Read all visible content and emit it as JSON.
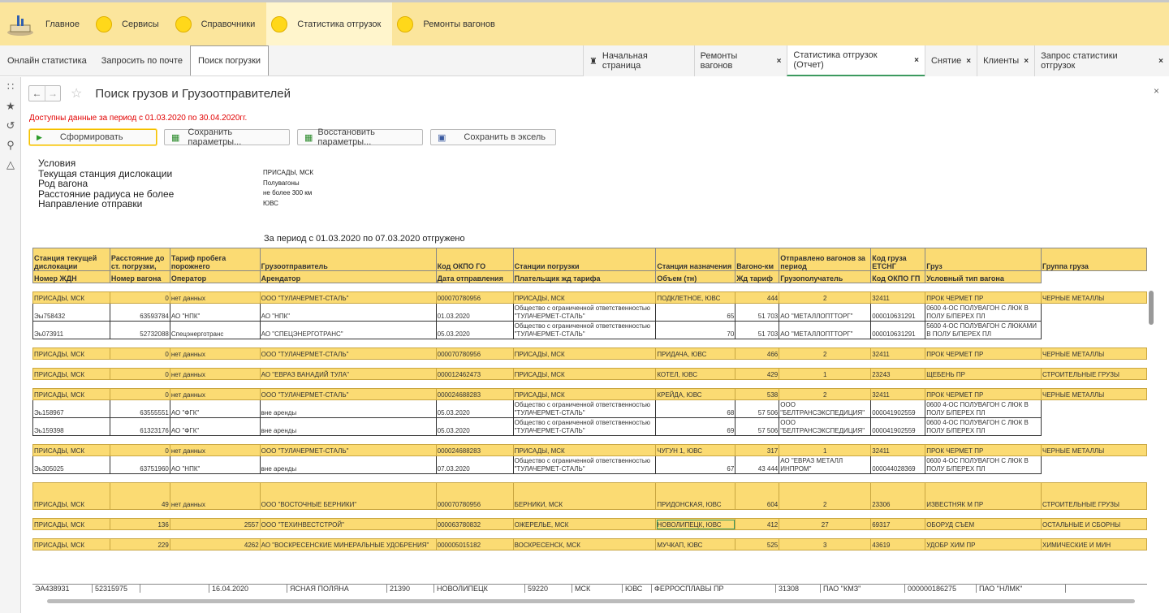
{
  "sections": [
    {
      "label": "Главное"
    },
    {
      "label": "Сервисы"
    },
    {
      "label": "Справочники"
    },
    {
      "label": "Статистика отгрузок"
    },
    {
      "label": "Ремонты вагонов"
    }
  ],
  "subnav": [
    "Онлайн статистика",
    "Запросить по почте",
    "Поиск погрузки"
  ],
  "tabs": [
    "Начальная страница",
    "Ремонты вагонов",
    "Статистика отгрузок (Отчет)",
    "Снятие",
    "Клиенты",
    "Запрос статистики отгрузок"
  ],
  "page": {
    "title": "Поиск грузов и Грузоотправителей",
    "warning": "Доступны данные за период с 01.03.2020 по 30.04.2020гг.",
    "buttons": [
      "Сформировать",
      "Сохранить параметры...",
      "Восстановить параметры...",
      "Сохранить в эксель"
    ],
    "conditions_title": "Условия",
    "conditions": [
      {
        "label": "Текущая станция дислокации",
        "value": "ПРИСАДЫ, МСК"
      },
      {
        "label": "Род вагона",
        "value": "Полувагоны"
      },
      {
        "label": "Расстояние радиуса не более",
        "value": "не более 300 км"
      },
      {
        "label": "Направление отправки",
        "value": "ЮВС"
      }
    ],
    "period": "За период с 01.03.2020 по 07.03.2020 отгружено"
  },
  "table": {
    "header1": [
      "Станция текущей дислокации",
      "Расстояние до ст. погрузки,",
      "Тариф пробега порожнего",
      "Грузоотправитель",
      "Код ОКПО ГО",
      "Станции погрузки",
      "Станция назначения",
      "Вагоно-км",
      "Отправлено вагонов за период",
      "Код груза ЕТСНГ",
      "Груз",
      "Группа груза"
    ],
    "header2": [
      "Номер ЖДН",
      "Номер вагона",
      "Оператор",
      "Арендатор",
      "Дата отправления",
      "Плательщик жд тарифа",
      "Объем (тн)",
      "Жд тариф",
      "Грузополучатель",
      "Код ОКПО ГП",
      "Условный тип вагона",
      ""
    ],
    "rows": [
      {
        "t": "sp"
      },
      {
        "t": "g",
        "c": [
          "ПРИСАДЫ, МСК",
          "0",
          "нет данных",
          "ООО \"ТУЛАЧЕРМЕТ-СТАЛЬ\"",
          "000070780956",
          "ПРИСАДЫ, МСК",
          "ПОДКЛЕТНОЕ, ЮВС",
          "444",
          "2",
          "32411",
          "ПРОК ЧЕРМЕТ ПР",
          "ЧЕРНЫЕ МЕТАЛЛЫ"
        ]
      },
      {
        "t": "d",
        "c": [
          "Эы758432",
          "63593784",
          "АО \"НПК\"",
          "АО \"НПК\"",
          "01.03.2020",
          "Общество с ограниченной ответственностью \"ТУЛАЧЕРМЕТ-СТАЛЬ\"",
          "65",
          "51 703",
          "АО \"МЕТАЛЛОПТТОРГ\"",
          "000010631291",
          "0600 4-ОС ПОЛУВАГОН С ЛЮК В ПОЛУ Б/ПЕРЕХ ПЛ",
          ""
        ]
      },
      {
        "t": "d",
        "c": [
          "Эь073911",
          "52732088",
          "Спецэнерготранс",
          "АО \"СПЕЦЭНЕРГОТРАНС\"",
          "05.03.2020",
          "Общество с ограниченной ответственностью \"ТУЛАЧЕРМЕТ-СТАЛЬ\"",
          "70",
          "51 703",
          "АО \"МЕТАЛЛОПТТОРГ\"",
          "000010631291",
          "5600 4-ОС ПОЛУВАГОН С ЛЮКАМИ В ПОЛУ Б/ПЕРЕХ ПЛ",
          ""
        ]
      },
      {
        "t": "sp"
      },
      {
        "t": "g",
        "c": [
          "ПРИСАДЫ, МСК",
          "0",
          "нет данных",
          "ООО \"ТУЛАЧЕРМЕТ-СТАЛЬ\"",
          "000070780956",
          "ПРИСАДЫ, МСК",
          "ПРИДАЧА, ЮВС",
          "466",
          "2",
          "32411",
          "ПРОК ЧЕРМЕТ ПР",
          "ЧЕРНЫЕ МЕТАЛЛЫ"
        ]
      },
      {
        "t": "sp"
      },
      {
        "t": "g",
        "c": [
          "ПРИСАДЫ, МСК",
          "0",
          "нет данных",
          "АО \"ЕВРАЗ ВАНАДИЙ ТУЛА\"",
          "000012462473",
          "ПРИСАДЫ, МСК",
          "КОТЕЛ, ЮВС",
          "429",
          "1",
          "23243",
          "ЩЕБЕНЬ ПР",
          "СТРОИТЕЛЬНЫЕ ГРУЗЫ"
        ]
      },
      {
        "t": "sp"
      },
      {
        "t": "g",
        "c": [
          "ПРИСАДЫ, МСК",
          "0",
          "нет данных",
          "ООО \"ТУЛАЧЕРМЕТ-СТАЛЬ\"",
          "000024688283",
          "ПРИСАДЫ, МСК",
          "КРЕЙДА, ЮВС",
          "538",
          "2",
          "32411",
          "ПРОК ЧЕРМЕТ ПР",
          "ЧЕРНЫЕ МЕТАЛЛЫ"
        ]
      },
      {
        "t": "d",
        "c": [
          "Эь158967",
          "63555551",
          "АО \"ФГК\"",
          "вне аренды",
          "05.03.2020",
          "Общество с ограниченной ответственностью \"ТУЛАЧЕРМЕТ-СТАЛЬ\"",
          "68",
          "57 506",
          "ООО \"БЕЛТРАНСЭКСПЕДИЦИЯ\"",
          "000041902559",
          "0600 4-ОС ПОЛУВАГОН С ЛЮК В ПОЛУ Б/ПЕРЕХ ПЛ",
          ""
        ]
      },
      {
        "t": "d",
        "c": [
          "Эь159398",
          "61323176",
          "АО \"ФГК\"",
          "вне аренды",
          "05.03.2020",
          "Общество с ограниченной ответственностью \"ТУЛАЧЕРМЕТ-СТАЛЬ\"",
          "69",
          "57 506",
          "ООО \"БЕЛТРАНСЭКСПЕДИЦИЯ\"",
          "000041902559",
          "0600 4-ОС ПОЛУВАГОН С ЛЮК В ПОЛУ Б/ПЕРЕХ ПЛ",
          ""
        ]
      },
      {
        "t": "sp"
      },
      {
        "t": "g",
        "c": [
          "ПРИСАДЫ, МСК",
          "0",
          "нет данных",
          "ООО \"ТУЛАЧЕРМЕТ-СТАЛЬ\"",
          "000024688283",
          "ПРИСАДЫ, МСК",
          "ЧУГУН 1, ЮВС",
          "317",
          "1",
          "32411",
          "ПРОК ЧЕРМЕТ ПР",
          "ЧЕРНЫЕ МЕТАЛЛЫ"
        ]
      },
      {
        "t": "d",
        "c": [
          "Эь305025",
          "63751960",
          "АО \"НПК\"",
          "вне аренды",
          "07.03.2020",
          "Общество с ограниченной ответственностью \"ТУЛАЧЕРМЕТ-СТАЛЬ\"",
          "67",
          "43 444",
          "АО \"ЕВРАЗ МЕТАЛЛ ИНПРОМ\"",
          "000044028369",
          "0600 4-ОС ПОЛУВАГОН С ЛЮК В ПОЛУ Б/ПЕРЕХ ПЛ",
          ""
        ]
      },
      {
        "t": "sp"
      },
      {
        "t": "gtall",
        "c": [
          "ПРИСАДЫ, МСК",
          "49",
          "нет данных",
          "ООО \"ВОСТОЧНЫЕ БЕРНИКИ\"",
          "000070780956",
          "БЕРНИКИ, МСК",
          "ПРИДОНСКАЯ, ЮВС",
          "604",
          "2",
          "23306",
          "ИЗВЕСТНЯК М ПР",
          "СТРОИТЕЛЬНЫЕ ГРУЗЫ"
        ]
      },
      {
        "t": "sp"
      },
      {
        "t": "g",
        "c": [
          "ПРИСАДЫ, МСК",
          "136",
          "2557",
          "ООО \"ТЕХИНВЕСТСТРОЙ\"",
          "000063780832",
          "ОЖЕРЕЛЬЕ, МСК",
          "НОВОЛИПЕЦК, ЮВС",
          "412",
          "27",
          "69317",
          "ОБОРУД СЪЕМ",
          "ОСТАЛЬНЫЕ И СБОРНЫ"
        ]
      },
      {
        "t": "sp"
      },
      {
        "t": "g",
        "c": [
          "ПРИСАДЫ, МСК",
          "229",
          "4262",
          "АО \"ВОСКРЕСЕНСКИЕ МИНЕРАЛЬНЫЕ УДОБРЕНИЯ\"",
          "000005015182",
          "ВОСКРЕСЕНСК, МСК",
          "МУЧКАП, ЮВС",
          "525",
          "3",
          "43619",
          "УДОБР ХИМ ПР",
          "ХИМИЧЕСКИЕ И МИН"
        ]
      }
    ],
    "footer": [
      "ЭА438931",
      "52315975",
      "",
      "16.04.2020",
      "ЯСНАЯ ПОЛЯНА",
      "21390",
      "НОВОЛИПЕЦК",
      "59220",
      "МСК",
      "ЮВС",
      "ФЕРРОСПЛАВЫ ПР",
      "31308",
      "ПАО \"КМЗ\"",
      "000000186275",
      "ПАО \"НЛМК\""
    ]
  }
}
